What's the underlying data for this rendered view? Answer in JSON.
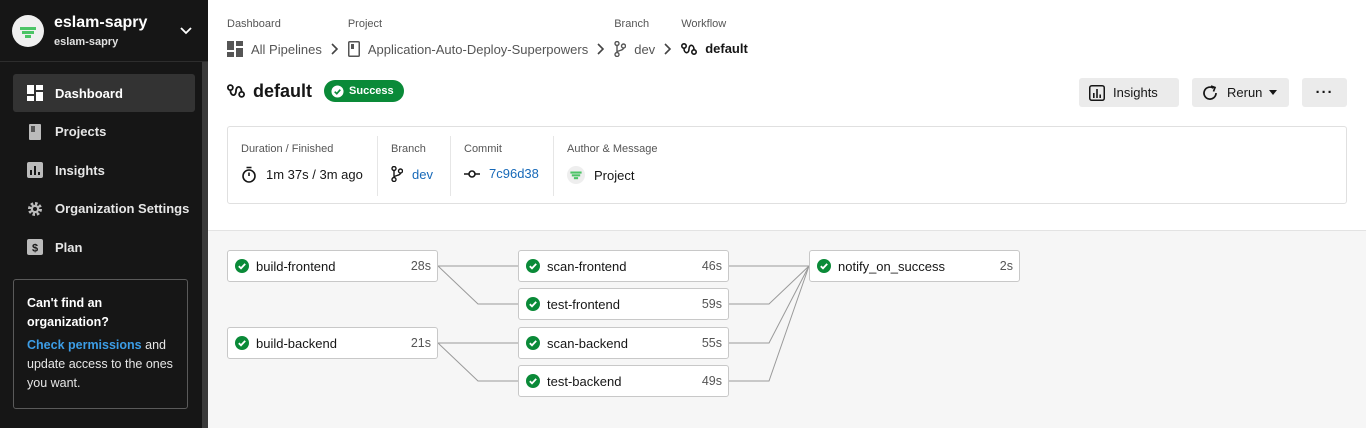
{
  "org": {
    "name": "eslam-sapry",
    "sub": "eslam-sapry"
  },
  "nav": [
    {
      "label": "Dashboard",
      "icon": "dashboard-icon",
      "active": true
    },
    {
      "label": "Projects",
      "icon": "projects-icon"
    },
    {
      "label": "Insights",
      "icon": "insights-icon"
    },
    {
      "label": "Organization Settings",
      "icon": "gear-icon"
    },
    {
      "label": "Plan",
      "icon": "dollar-icon"
    }
  ],
  "promo": {
    "title": "Can't find an organization?",
    "link": "Check permissions",
    "body": "and update access to the ones you want."
  },
  "breadcrumb": {
    "dashboard_label": "Dashboard",
    "dashboard_value": "All Pipelines",
    "project_label": "Project",
    "project_value": "Application-Auto-Deploy-Superpowers",
    "branch_label": "Branch",
    "branch_value": "dev",
    "workflow_label": "Workflow",
    "workflow_value": "default"
  },
  "workflow": {
    "title": "default",
    "status": "Success",
    "status_color": "#0a8a38"
  },
  "actions": {
    "insights": "Insights",
    "rerun": "Rerun",
    "more": "···"
  },
  "info": {
    "duration_label": "Duration / Finished",
    "duration_value": "1m 37s / 3m ago",
    "branch_label": "Branch",
    "branch_value": "dev",
    "commit_label": "Commit",
    "commit_value": "7c96d38",
    "author_label": "Author & Message",
    "author_value": "Project"
  },
  "jobs": {
    "build_frontend": {
      "name": "build-frontend",
      "duration": "28s"
    },
    "build_backend": {
      "name": "build-backend",
      "duration": "21s"
    },
    "scan_frontend": {
      "name": "scan-frontend",
      "duration": "46s"
    },
    "test_frontend": {
      "name": "test-frontend",
      "duration": "59s"
    },
    "scan_backend": {
      "name": "scan-backend",
      "duration": "55s"
    },
    "test_backend": {
      "name": "test-backend",
      "duration": "49s"
    },
    "notify": {
      "name": "notify_on_success",
      "duration": "2s"
    }
  },
  "colors": {
    "success": "#0a8a38",
    "link": "#1769b8",
    "sidebar": "#161616"
  }
}
